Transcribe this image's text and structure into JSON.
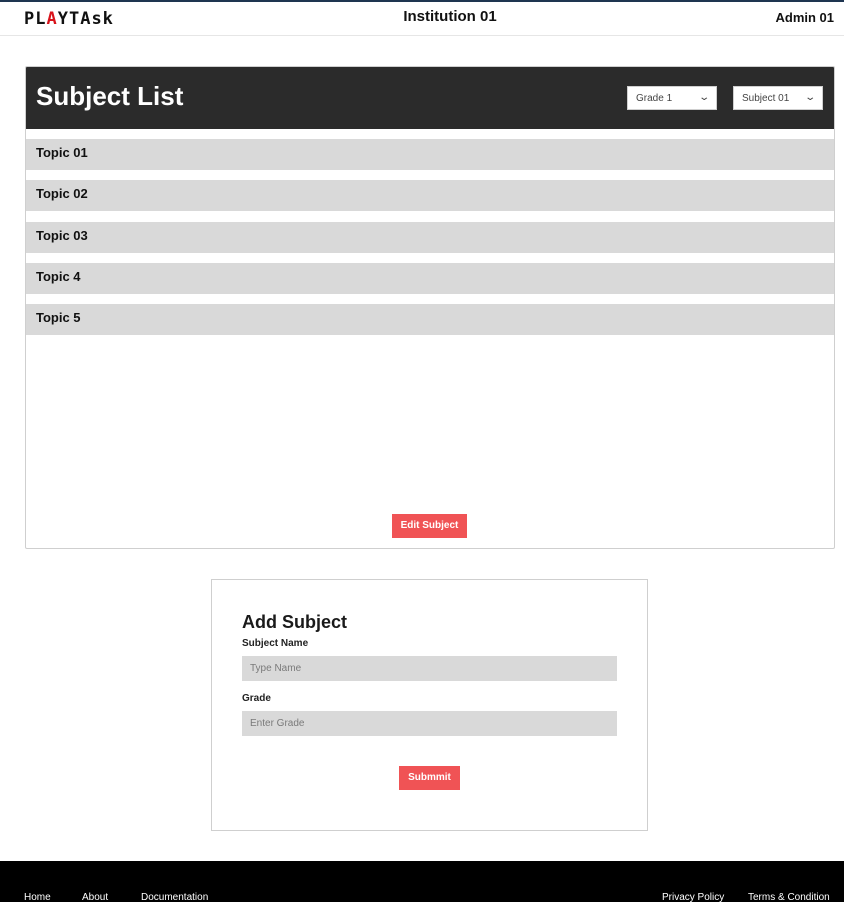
{
  "header": {
    "logo": {
      "part1": "PL",
      "part2": "A",
      "part3": "YTAsk"
    },
    "institution": "Institution 01",
    "user": "Admin 01"
  },
  "subject_list": {
    "title": "Subject List",
    "grade_select": {
      "value": "Grade 1"
    },
    "subject_select": {
      "value": "Subject 01"
    },
    "topics": [
      "Topic 01",
      "Topic 02",
      "Topic 03",
      "Topic 4",
      "Topic 5"
    ],
    "edit_button": "Edit Subject"
  },
  "add_subject": {
    "title": "Add Subject",
    "name_label": "Subject Name",
    "name_placeholder": "Type Name",
    "grade_label": "Grade",
    "grade_placeholder": "Enter Grade",
    "submit": "Submmit"
  },
  "footer": {
    "links": [
      "Home",
      "About",
      "Documentation",
      "Privacy Policy",
      "Terms & Condition"
    ]
  },
  "colors": {
    "accent": "#f05355",
    "header_dark": "#2b2b2b",
    "topic_bg": "#d9d9d9",
    "logo_red": "#d8131b"
  }
}
